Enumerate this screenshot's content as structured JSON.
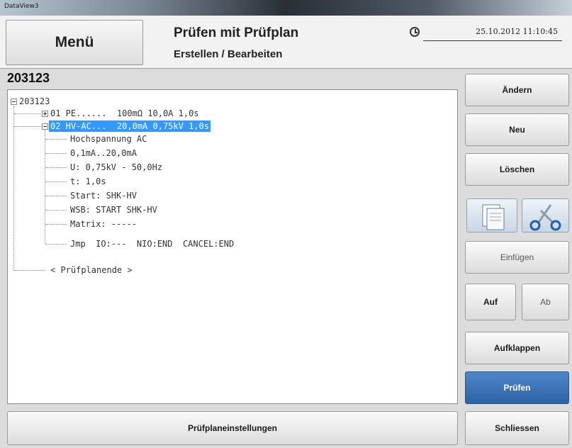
{
  "window": {
    "title": "DataView3"
  },
  "header": {
    "menu_label": "Menü",
    "title": "Prüfen mit Prüfplan",
    "subtitle": "Erstellen / Bearbeiten",
    "datetime": "25.10.2012  11:10:45"
  },
  "plan": {
    "id": "203123",
    "tree": {
      "root": "203123",
      "step1": "01 PE......  100mΩ 10,0A 1,0s",
      "step2": "02 HV-AC...  20,0mA 0,75kV 1,0s",
      "details": [
        "Hochspannung AC",
        "0,1mA..20,0mA",
        "U: 0,75kV - 50,0Hz",
        "t: 1,0s",
        "Start: SHK-HV",
        "WSB: START SHK-HV",
        "Matrix: -----",
        "Jmp  IO:---  NIO:END  CANCEL:END"
      ],
      "end": "< Prüfplanende >"
    }
  },
  "sidebar": {
    "aendern": "Ändern",
    "neu": "Neu",
    "loeschen": "Löschen",
    "copy_icon": "copy-icon",
    "cut_icon": "scissors-icon",
    "einfuegen": "Einfügen",
    "auf": "Auf",
    "ab": "Ab",
    "aufklappen": "Aufklappen",
    "pruefen": "Prüfen",
    "schliessen": "Schliessen"
  },
  "footer": {
    "settings_label": "Prüfplaneinstellungen"
  },
  "colors": {
    "selection": "#3399ff",
    "primary": "#2e63a6"
  }
}
